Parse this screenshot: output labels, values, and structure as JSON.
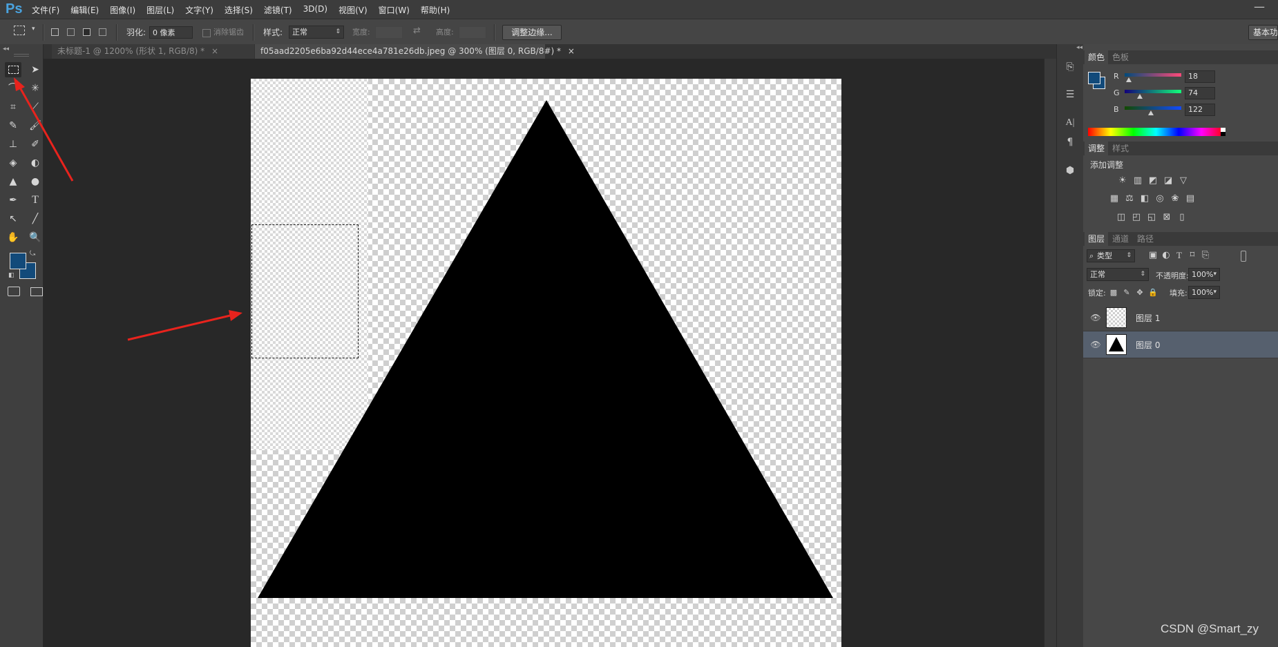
{
  "app": {
    "logo": "Ps",
    "minimize_glyph": "—"
  },
  "menu": [
    "文件(F)",
    "编辑(E)",
    "图像(I)",
    "图层(L)",
    "文字(Y)",
    "选择(S)",
    "滤镜(T)",
    "3D(D)",
    "视图(V)",
    "窗口(W)",
    "帮助(H)"
  ],
  "options": {
    "feather_label": "羽化:",
    "feather_value": "0 像素",
    "antialias_label": "消除锯齿",
    "style_label": "样式:",
    "style_value": "正常",
    "width_label": "宽度:",
    "height_label": "高度:",
    "refine_edge_button": "调整边缘...",
    "workspace_button": "基本功"
  },
  "tabs": [
    {
      "label": "未标题-1 @ 1200% (形状 1, RGB/8) *",
      "close": "×",
      "active": false
    },
    {
      "label": "f05aad2205e6ba92d44ece4a781e26db.jpeg @ 300% (图层 0, RGB/8#) *",
      "close": "×",
      "active": true
    }
  ],
  "colors": {
    "foreground": "#124a7a",
    "background": "#124a7a",
    "arrow": "#e8231d"
  },
  "color_panel": {
    "tabs": [
      "颜色",
      "色板"
    ],
    "r_label": "R",
    "r_value": "18",
    "g_label": "G",
    "g_value": "74",
    "b_label": "B",
    "b_value": "122"
  },
  "adjust_panel": {
    "tabs": [
      "调整",
      "样式"
    ],
    "title": "添加调整"
  },
  "layers_panel": {
    "tabs": [
      "图层",
      "通道",
      "路径"
    ],
    "filter_label": "类型",
    "blend_mode": "正常",
    "opacity_label": "不透明度:",
    "opacity_value": "100%",
    "lock_label": "锁定:",
    "fill_label": "填充:",
    "fill_value": "100%",
    "layers": [
      {
        "name": "图层 1",
        "selected": false
      },
      {
        "name": "图层 0",
        "selected": true
      }
    ]
  },
  "watermark": "CSDN @Smart_zy"
}
